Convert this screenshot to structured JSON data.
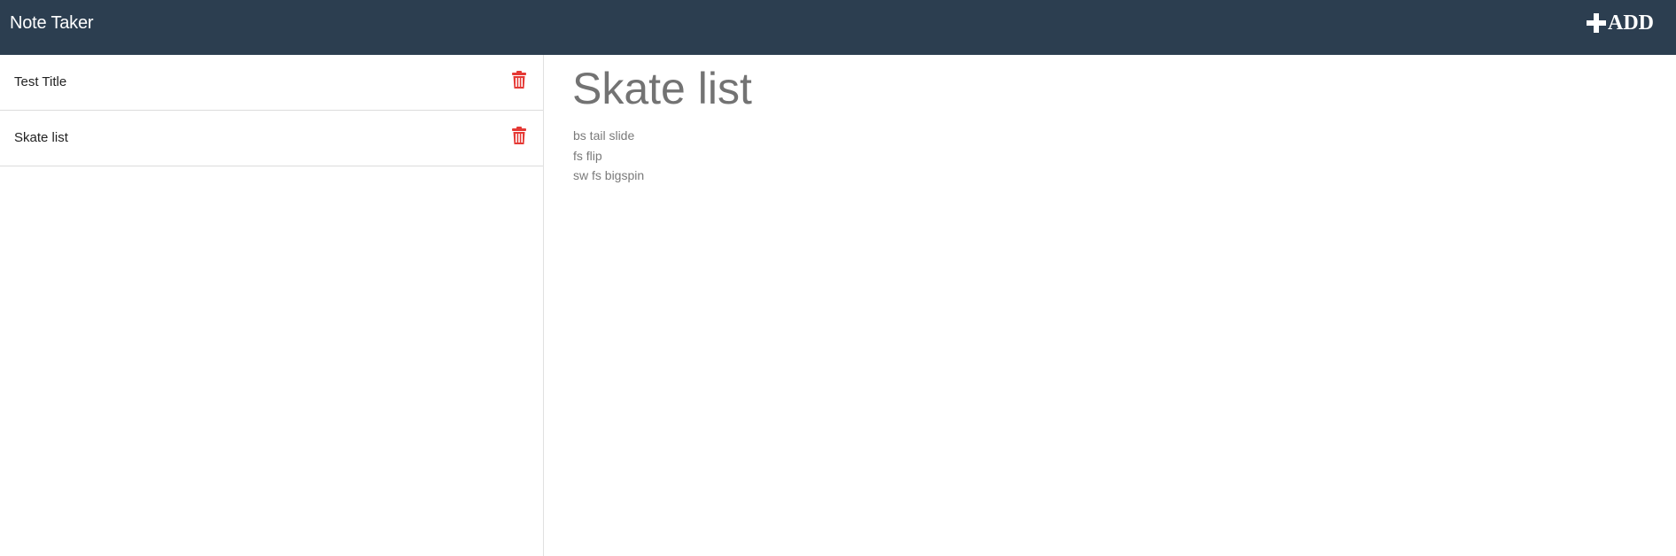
{
  "header": {
    "brand": "Note Taker",
    "add_label": "ADD",
    "add_icon": "plus-icon"
  },
  "colors": {
    "navbar_bg": "#2c3e50",
    "delete_icon": "#e53935",
    "heading_text": "#737373"
  },
  "sidebar": {
    "notes": [
      {
        "title": "Test Title",
        "delete_icon": "trash-icon"
      },
      {
        "title": "Skate list",
        "delete_icon": "trash-icon"
      }
    ]
  },
  "main": {
    "title": "Skate list",
    "lines": [
      "bs tail slide",
      "fs flip",
      "sw fs bigspin"
    ]
  }
}
